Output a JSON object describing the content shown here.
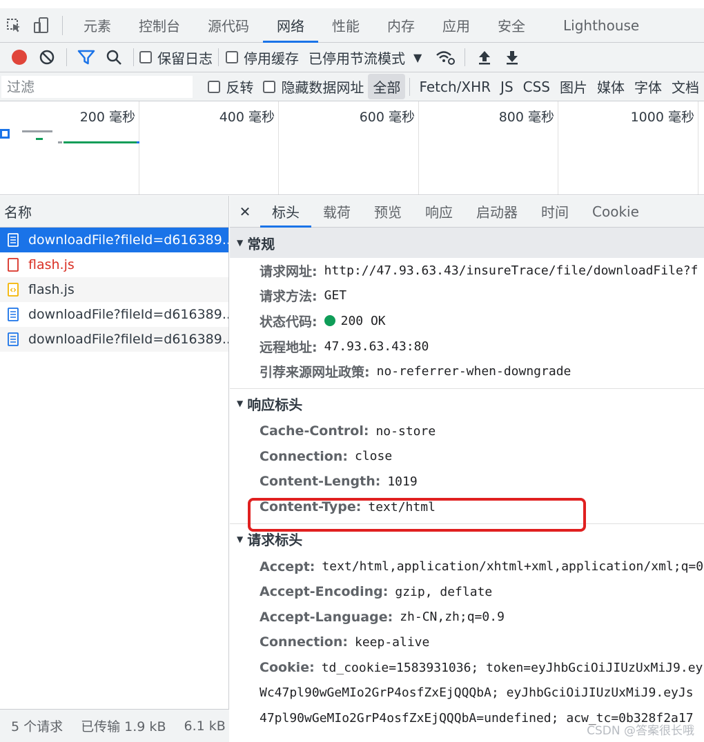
{
  "main_tabs": [
    {
      "label": "元素",
      "active": false
    },
    {
      "label": "控制台",
      "active": false
    },
    {
      "label": "源代码",
      "active": false
    },
    {
      "label": "网络",
      "active": true
    },
    {
      "label": "性能",
      "active": false
    },
    {
      "label": "内存",
      "active": false
    },
    {
      "label": "应用",
      "active": false
    },
    {
      "label": "安全",
      "active": false
    },
    {
      "label": "Lighthouse",
      "active": false
    }
  ],
  "toolbar": {
    "preserve_log": "保留日志",
    "disable_cache": "停用缓存",
    "throttling": "已停用节流模式",
    "record_color": "#e0453a",
    "filter_color": "#1a73e8"
  },
  "filterbar": {
    "placeholder": "过滤",
    "invert": "反转",
    "hide_data_urls": "隐藏数据网址",
    "types": [
      "全部",
      "Fetch/XHR",
      "JS",
      "CSS",
      "图片",
      "媒体",
      "字体",
      "文档"
    ]
  },
  "overview": {
    "labels": [
      "200 毫秒",
      "400 毫秒",
      "600 毫秒",
      "800 毫秒",
      "1000 毫秒"
    ]
  },
  "request_list": {
    "header": "名称",
    "rows": [
      {
        "name": "downloadFile?fileId=d616389...",
        "type": "doc",
        "selected": true,
        "error": false
      },
      {
        "name": "flash.js",
        "type": "err",
        "selected": false,
        "error": true
      },
      {
        "name": "flash.js",
        "type": "script",
        "selected": false,
        "error": false
      },
      {
        "name": "downloadFile?fileId=d616389...",
        "type": "doc",
        "selected": false,
        "error": false
      },
      {
        "name": "downloadFile?fileId=d616389...",
        "type": "doc",
        "selected": false,
        "error": false
      }
    ],
    "status": {
      "requests": "5 个请求",
      "transferred": "已传输 1.9 kB",
      "resources": "6.1 kB"
    }
  },
  "detail_tabs": [
    {
      "label": "标头",
      "active": true
    },
    {
      "label": "载荷",
      "active": false
    },
    {
      "label": "预览",
      "active": false
    },
    {
      "label": "响应",
      "active": false
    },
    {
      "label": "启动器",
      "active": false
    },
    {
      "label": "时间",
      "active": false
    },
    {
      "label": "Cookie",
      "active": false
    }
  ],
  "general": {
    "title": "常规",
    "request_url_key": "请求网址:",
    "request_url": "http://47.93.63.43/insureTrace/file/downloadFile?f",
    "method_key": "请求方法:",
    "method": "GET",
    "status_key": "状态代码:",
    "status": "200 OK",
    "remote_key": "远程地址:",
    "remote": "47.93.63.43:80",
    "referrer_key": "引荐来源网址政策:",
    "referrer": "no-referrer-when-downgrade"
  },
  "response_headers": {
    "title": "响应标头",
    "items": [
      {
        "key": "Cache-Control:",
        "value": "no-store"
      },
      {
        "key": "Connection:",
        "value": "close"
      },
      {
        "key": "Content-Length:",
        "value": "1019"
      },
      {
        "key": "Content-Type:",
        "value": "text/html"
      }
    ]
  },
  "request_headers": {
    "title": "请求标头",
    "items": [
      {
        "key": "Accept:",
        "value": "text/html,application/xhtml+xml,application/xml;q=0"
      },
      {
        "key": "Accept-Encoding:",
        "value": "gzip, deflate"
      },
      {
        "key": "Accept-Language:",
        "value": "zh-CN,zh;q=0.9"
      },
      {
        "key": "Connection:",
        "value": "keep-alive"
      },
      {
        "key": "Cookie:",
        "value": "td_cookie=1583931036; token=eyJhbGciOiJIUzUxMiJ9.ey"
      }
    ],
    "cookie_cont1": "Wc47pl90wGeMIo2GrP4osfZxEjQQQbA; eyJhbGciOiJIUzUxMiJ9.eyJs",
    "cookie_cont2": "47pl90wGeMIo2GrP4osfZxEjQQQbA=undefined; acw_tc=0b328f2a17"
  },
  "watermark": "CSDN @答案很长哦"
}
